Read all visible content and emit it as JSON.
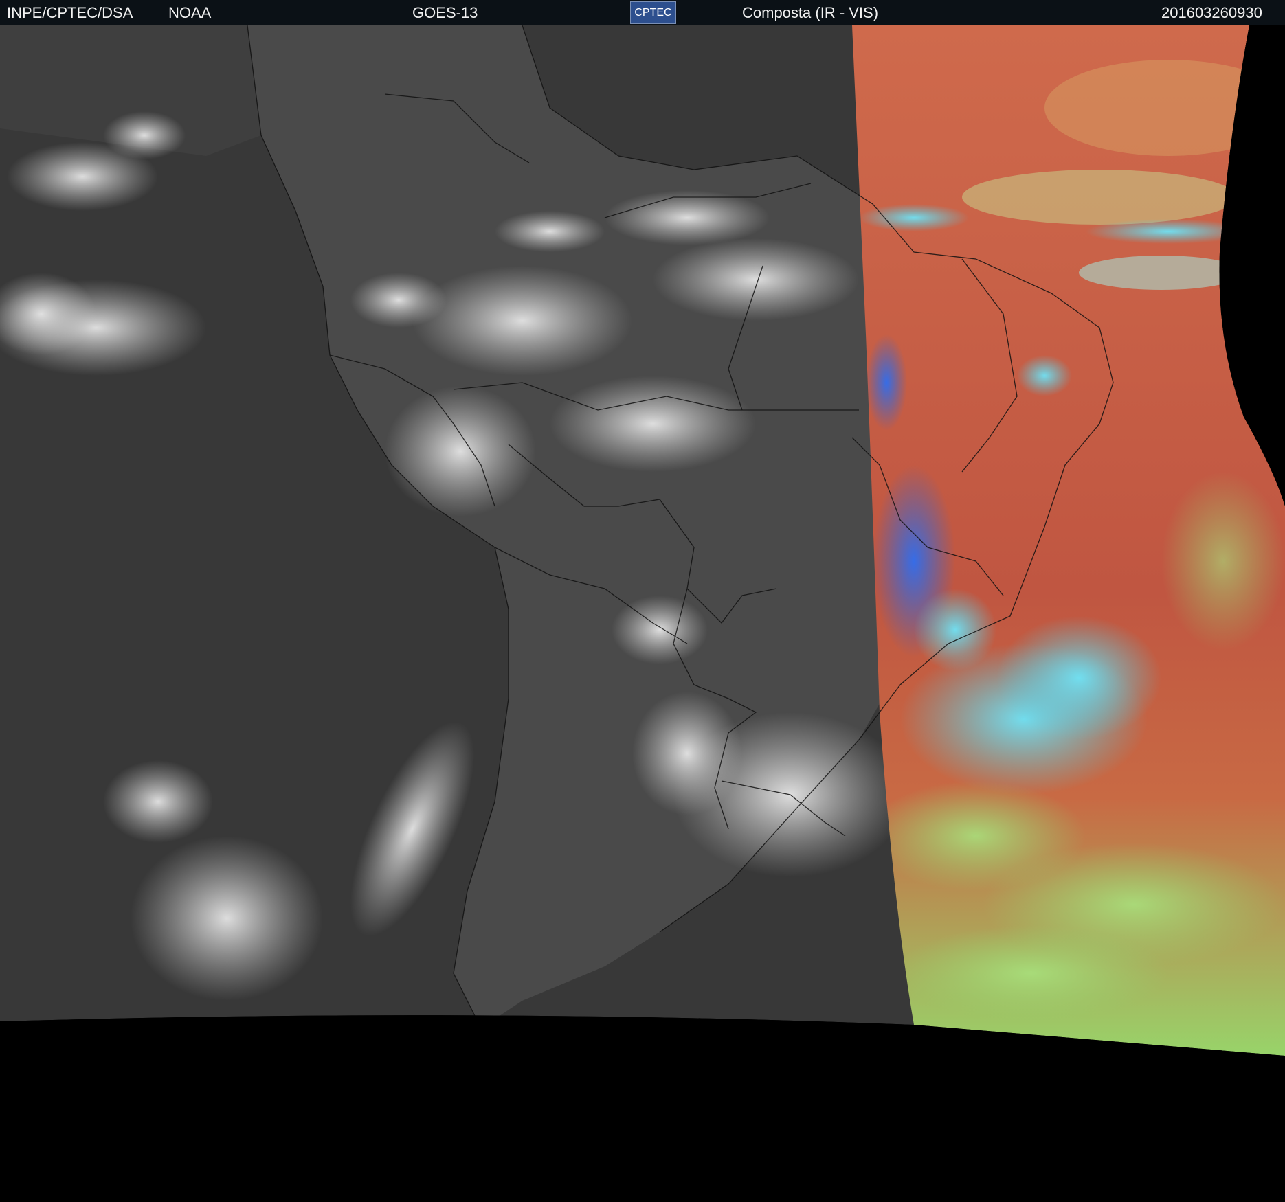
{
  "header": {
    "org": "INPE/CPTEC/DSA",
    "agency": "NOAA",
    "satellite": "GOES-13",
    "logo_text": "CPTEC",
    "product": "Composta (IR - VIS)",
    "timestamp": "201603260930"
  },
  "colors": {
    "header_bg": "#0b1116",
    "ir_gray": "#3a3a3a",
    "vis_red": "#c25b44",
    "vis_cyan": "#4fd0e8",
    "vis_green": "#93d26d",
    "vis_blue": "#2b63d6"
  }
}
